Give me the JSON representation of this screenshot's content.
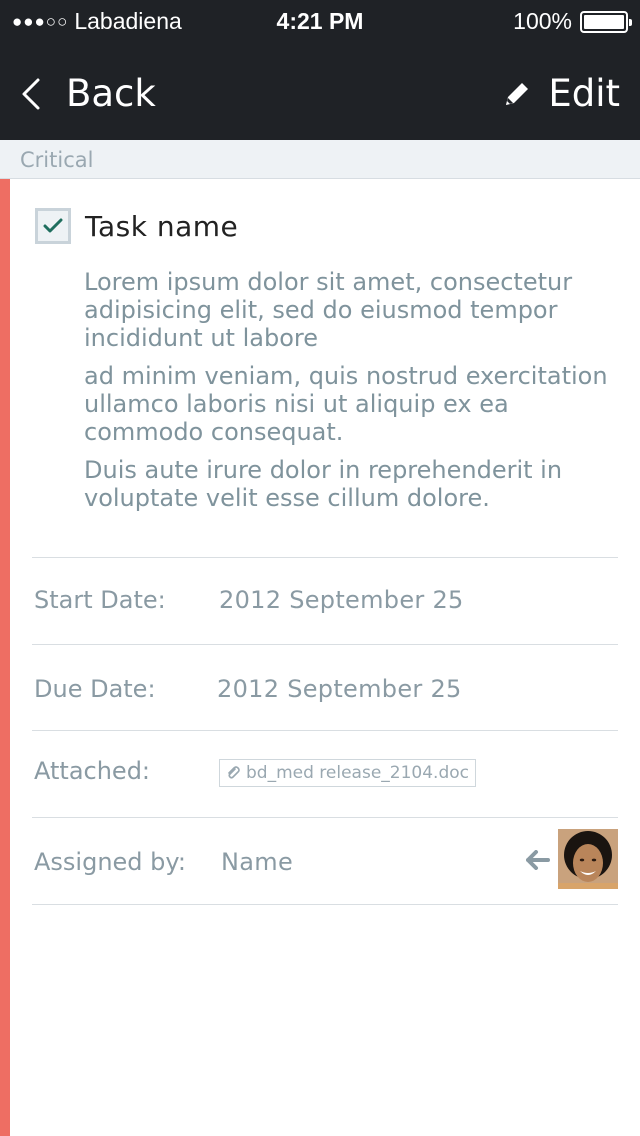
{
  "status_bar": {
    "signal_dots": "●●●○○",
    "carrier": "Labadiena",
    "time": "4:21 PM",
    "battery": "100%"
  },
  "nav": {
    "back_label": "Back",
    "edit_label": "Edit"
  },
  "section": {
    "title": "Critical",
    "accent_color": "#ee6e63"
  },
  "task": {
    "name": "Task name",
    "completed": true,
    "description": [
      "Lorem ipsum dolor sit amet, consectetur adipisicing elit, sed do eiusmod tempor incididunt ut labore",
      "ad minim veniam, quis nostrud exercitation ullamco laboris nisi ut aliquip ex ea commodo consequat.",
      "Duis aute irure dolor in reprehenderit in voluptate velit esse cillum dolore."
    ]
  },
  "details": {
    "start_label": "Start Date:",
    "start_value": "2012 September 25",
    "due_label": "Due Date:",
    "due_value": "2012 September 25",
    "attached_label": "Attached:",
    "attached_file": "bd_med release_2104.doc",
    "assigned_label": "Assigned by:",
    "assigned_value": "Name"
  },
  "icons": {
    "back": "chevron-left-icon",
    "edit": "pencil-icon",
    "check": "check-icon",
    "attachment": "paperclip-icon",
    "assigned_arrow": "arrow-left-icon",
    "avatar": "user-avatar"
  }
}
